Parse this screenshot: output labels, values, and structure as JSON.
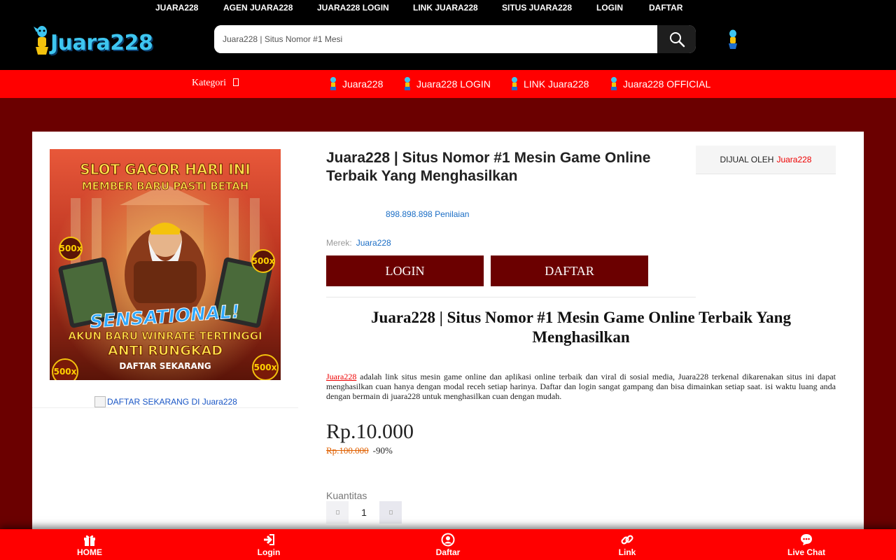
{
  "topnav": {
    "items": [
      "JUARA228",
      "AGEN JUARA228",
      "JUARA228 LOGIN",
      "LINK JUARA228",
      "SITUS JUARA228",
      "LOGIN",
      "DAFTAR"
    ]
  },
  "logo": {
    "text": "Juara228"
  },
  "search": {
    "value": "Juara228 | Situs Nomor #1 Mesi"
  },
  "catbar": {
    "kategori": "Kategori",
    "links": [
      "Juara228",
      "Juara228 LOGIN",
      "LINK Juara228",
      "Juara228 OFFICIAL"
    ]
  },
  "banner": {
    "line1": "SLOT GACOR HARI INI",
    "line2": "MEMBER BARU PASTI BETAH",
    "line3": "SENSATIONAL!",
    "line4": "AKUN BARU WINRATE TERTINGGI",
    "line5": "ANTI RUNGKAD",
    "line6": "DAFTAR SEKARANG",
    "badge": "500x",
    "link_alt": "DAFTAR SEKARANG DI Juara228"
  },
  "product": {
    "title": "Juara228 | Situs Nomor #1 Mesin Game Online Terbaik Yang Menghasilkan",
    "seller_label": "DIJUAL OLEH",
    "seller_name": "Juara228",
    "rating": "898.898.898 Penilaian",
    "brand_label": "Merek:",
    "brand_value": "Juara228",
    "login_btn": "LOGIN",
    "daftar_btn": "DAFTAR",
    "heading": "Juara228 | Situs Nomor #1 Mesin Game Online Terbaik Yang Menghasilkan",
    "desc_link": "Juara228",
    "desc_rest": " adalah link situs mesin game online dan aplikasi online terbaik dan viral di sosial media, Juara228 terkenal dikarenakan situs ini dapat menghasilkan cuan hanya dengan modal receh setiap harinya. Daftar dan login sangat gampang dan bisa dimainkan setiap saat. isi waktu luang anda dengan bermain di juara228 untuk menghasilkan cuan dengan mudah.",
    "price": "Rp.10.000",
    "old_price": "Rp.100.000",
    "discount": "-90%",
    "qty_label": "Kuantitas",
    "qty_value": "1"
  },
  "bottomnav": {
    "items": [
      "HOME",
      "Login",
      "Daftar",
      "Link",
      "Live Chat"
    ]
  },
  "colors": {
    "background": "#6b0000",
    "accent_red": "#ff0000",
    "button": "#6b0000",
    "link_blue": "#1a6dc5"
  },
  "icons": {
    "search": "search-icon",
    "home": "gift-icon",
    "login": "sign-in-icon",
    "daftar": "user-circle-icon",
    "link": "link-icon",
    "livechat": "chat-icon"
  }
}
